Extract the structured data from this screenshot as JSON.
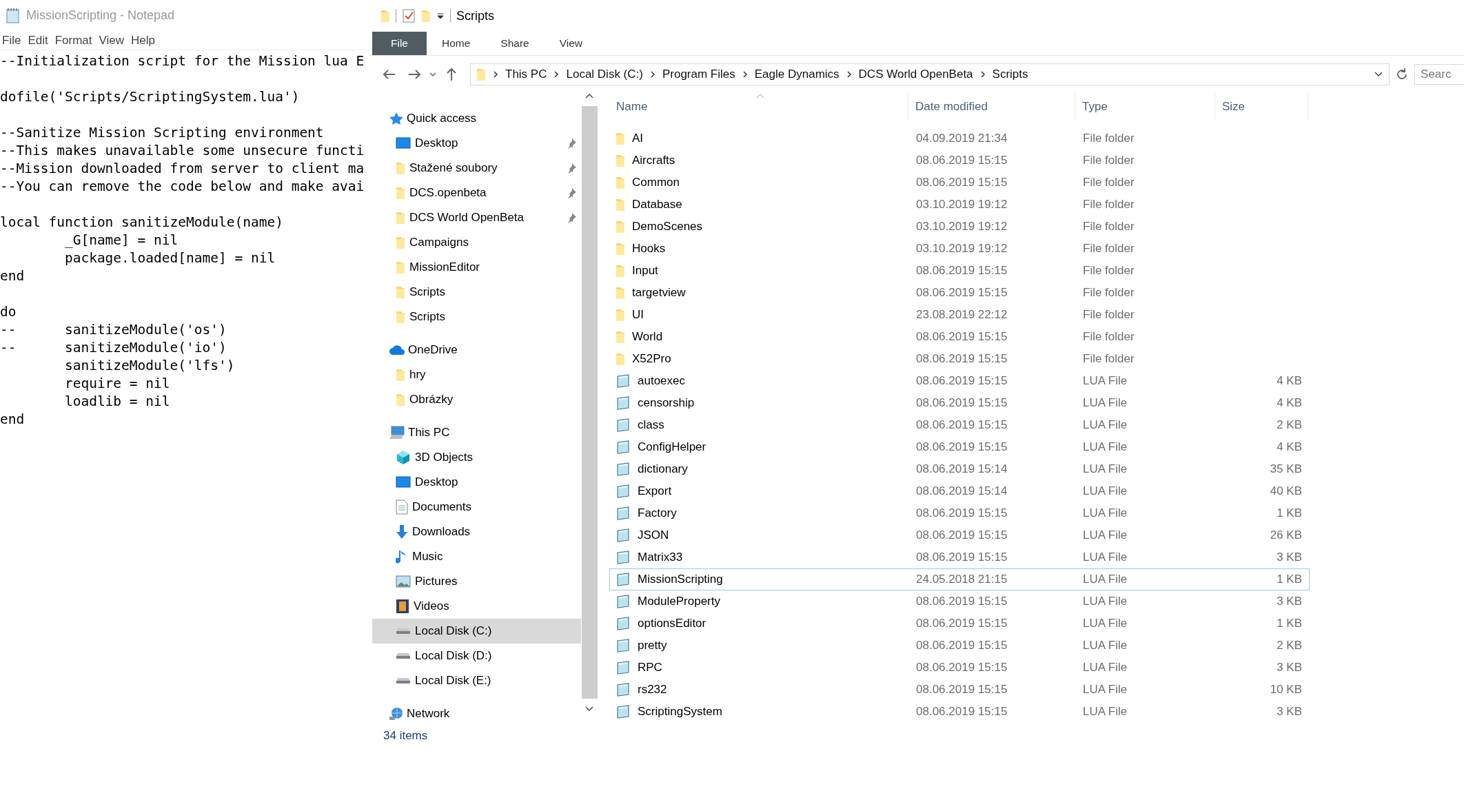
{
  "notepad": {
    "title": "MissionScripting - Notepad",
    "menu": [
      "File",
      "Edit",
      "Format",
      "View",
      "Help"
    ],
    "code_blocks": [
      [
        "--Initialization script for the Mission lua E"
      ],
      [
        "dofile('Scripts/ScriptingSystem.lua')"
      ],
      [
        "--Sanitize Mission Scripting environment",
        "--This makes unavailable some unsecure functi",
        "--Mission downloaded from server to client ma",
        "--You can remove the code below and make avai"
      ],
      [
        "local function sanitizeModule(name)",
        "\t_G[name] = nil",
        "\tpackage.loaded[name] = nil",
        "end"
      ],
      [
        "do",
        "--\tsanitizeModule('os')",
        "--\tsanitizeModule('io')",
        "\tsanitizeModule('lfs')",
        "\trequire = nil",
        "\tloadlib = nil",
        "end"
      ]
    ]
  },
  "explorer": {
    "title": "Scripts",
    "ribbon_tabs": [
      {
        "label": "File",
        "selected": true
      },
      {
        "label": "Home",
        "selected": false
      },
      {
        "label": "Share",
        "selected": false
      },
      {
        "label": "View",
        "selected": false
      }
    ],
    "address": [
      "This PC",
      "Local Disk (C:)",
      "Program Files",
      "Eagle Dynamics",
      "DCS World OpenBeta",
      "Scripts"
    ],
    "search": {
      "placeholder": "Searc"
    },
    "nav": [
      {
        "label": "Quick access",
        "kind": "star",
        "children": [
          {
            "label": "Desktop",
            "kind": "desktop",
            "pinned": true,
            "selected": false
          },
          {
            "label": "Stažené soubory",
            "kind": "folder",
            "pinned": true,
            "selected": false
          },
          {
            "label": "DCS.openbeta",
            "kind": "folder",
            "pinned": true,
            "selected": false
          },
          {
            "label": "DCS World OpenBeta",
            "kind": "folder",
            "pinned": true,
            "selected": false
          },
          {
            "label": "Campaigns",
            "kind": "folder",
            "pinned": false,
            "selected": false
          },
          {
            "label": "MissionEditor",
            "kind": "folder",
            "pinned": false,
            "selected": false
          },
          {
            "label": "Scripts",
            "kind": "folder",
            "pinned": false,
            "selected": false
          },
          {
            "label": "Scripts",
            "kind": "folder",
            "pinned": false,
            "selected": false
          }
        ]
      },
      {
        "label": "OneDrive",
        "kind": "cloud",
        "children": [
          {
            "label": "hry",
            "kind": "folder",
            "pinned": false,
            "selected": false
          },
          {
            "label": "Obrázky",
            "kind": "folder",
            "pinned": false,
            "selected": false
          }
        ]
      },
      {
        "label": "This PC",
        "kind": "pc",
        "children": [
          {
            "label": "3D Objects",
            "kind": "cube",
            "pinned": false,
            "selected": false
          },
          {
            "label": "Desktop",
            "kind": "desktop",
            "pinned": false,
            "selected": false
          },
          {
            "label": "Documents",
            "kind": "document",
            "pinned": false,
            "selected": false
          },
          {
            "label": "Downloads",
            "kind": "download",
            "pinned": false,
            "selected": false
          },
          {
            "label": "Music",
            "kind": "music",
            "pinned": false,
            "selected": false
          },
          {
            "label": "Pictures",
            "kind": "picture",
            "pinned": false,
            "selected": false
          },
          {
            "label": "Videos",
            "kind": "video",
            "pinned": false,
            "selected": false
          },
          {
            "label": "Local Disk (C:)",
            "kind": "drive",
            "pinned": false,
            "selected": true
          },
          {
            "label": "Local Disk (D:)",
            "kind": "drive",
            "pinned": false,
            "selected": false
          },
          {
            "label": "Local Disk (E:)",
            "kind": "drive",
            "pinned": false,
            "selected": false
          }
        ]
      },
      {
        "label": "Network",
        "kind": "network"
      }
    ],
    "columns": [
      "Name",
      "Date modified",
      "Type",
      "Size"
    ],
    "rows": [
      {
        "name": "AI",
        "kind": "folder",
        "date": "04.09.2019 21:34",
        "type": "File folder",
        "selected": false
      },
      {
        "name": "Aircrafts",
        "kind": "folder",
        "date": "08.06.2019 15:15",
        "type": "File folder",
        "selected": false
      },
      {
        "name": "Common",
        "kind": "folder",
        "date": "08.06.2019 15:15",
        "type": "File folder",
        "selected": false
      },
      {
        "name": "Database",
        "kind": "folder",
        "date": "03.10.2019 19:12",
        "type": "File folder",
        "selected": false
      },
      {
        "name": "DemoScenes",
        "kind": "folder",
        "date": "03.10.2019 19:12",
        "type": "File folder",
        "selected": false
      },
      {
        "name": "Hooks",
        "kind": "folder",
        "date": "03.10.2019 19:12",
        "type": "File folder",
        "selected": false
      },
      {
        "name": "Input",
        "kind": "folder",
        "date": "08.06.2019 15:15",
        "type": "File folder",
        "selected": false
      },
      {
        "name": "targetview",
        "kind": "folder",
        "date": "08.06.2019 15:15",
        "type": "File folder",
        "selected": false
      },
      {
        "name": "UI",
        "kind": "folder",
        "date": "23.08.2019 22:12",
        "type": "File folder",
        "selected": false
      },
      {
        "name": "World",
        "kind": "folder",
        "date": "08.06.2019 15:15",
        "type": "File folder",
        "selected": false
      },
      {
        "name": "X52Pro",
        "kind": "folder",
        "date": "08.06.2019 15:15",
        "type": "File folder",
        "selected": false
      },
      {
        "name": "autoexec",
        "kind": "lua",
        "date": "08.06.2019 15:15",
        "type": "LUA File",
        "size": "4 KB",
        "selected": false
      },
      {
        "name": "censorship",
        "kind": "lua",
        "date": "08.06.2019 15:15",
        "type": "LUA File",
        "size": "4 KB",
        "selected": false
      },
      {
        "name": "class",
        "kind": "lua",
        "date": "08.06.2019 15:15",
        "type": "LUA File",
        "size": "2 KB",
        "selected": false
      },
      {
        "name": "ConfigHelper",
        "kind": "lua",
        "date": "08.06.2019 15:15",
        "type": "LUA File",
        "size": "4 KB",
        "selected": false
      },
      {
        "name": "dictionary",
        "kind": "lua",
        "date": "08.06.2019 15:14",
        "type": "LUA File",
        "size": "35 KB",
        "selected": false
      },
      {
        "name": "Export",
        "kind": "lua",
        "date": "08.06.2019 15:14",
        "type": "LUA File",
        "size": "40 KB",
        "selected": false
      },
      {
        "name": "Factory",
        "kind": "lua",
        "date": "08.06.2019 15:15",
        "type": "LUA File",
        "size": "1 KB",
        "selected": false
      },
      {
        "name": "JSON",
        "kind": "lua",
        "date": "08.06.2019 15:15",
        "type": "LUA File",
        "size": "26 KB",
        "selected": false
      },
      {
        "name": "Matrix33",
        "kind": "lua",
        "date": "08.06.2019 15:15",
        "type": "LUA File",
        "size": "3 KB",
        "selected": false
      },
      {
        "name": "MissionScripting",
        "kind": "lua",
        "date": "24.05.2018 21:15",
        "type": "LUA File",
        "size": "1 KB",
        "selected": true
      },
      {
        "name": "ModuleProperty",
        "kind": "lua",
        "date": "08.06.2019 15:15",
        "type": "LUA File",
        "size": "3 KB",
        "selected": false
      },
      {
        "name": "optionsEditor",
        "kind": "lua",
        "date": "08.06.2019 15:15",
        "type": "LUA File",
        "size": "1 KB",
        "selected": false
      },
      {
        "name": "pretty",
        "kind": "lua",
        "date": "08.06.2019 15:15",
        "type": "LUA File",
        "size": "2 KB",
        "selected": false
      },
      {
        "name": "RPC",
        "kind": "lua",
        "date": "08.06.2019 15:15",
        "type": "LUA File",
        "size": "3 KB",
        "selected": false
      },
      {
        "name": "rs232",
        "kind": "lua",
        "date": "08.06.2019 15:15",
        "type": "LUA File",
        "size": "10 KB",
        "selected": false
      },
      {
        "name": "ScriptingSystem",
        "kind": "lua",
        "date": "08.06.2019 15:15",
        "type": "LUA File",
        "size": "3 KB",
        "selected": false
      }
    ],
    "status": "34 items"
  }
}
